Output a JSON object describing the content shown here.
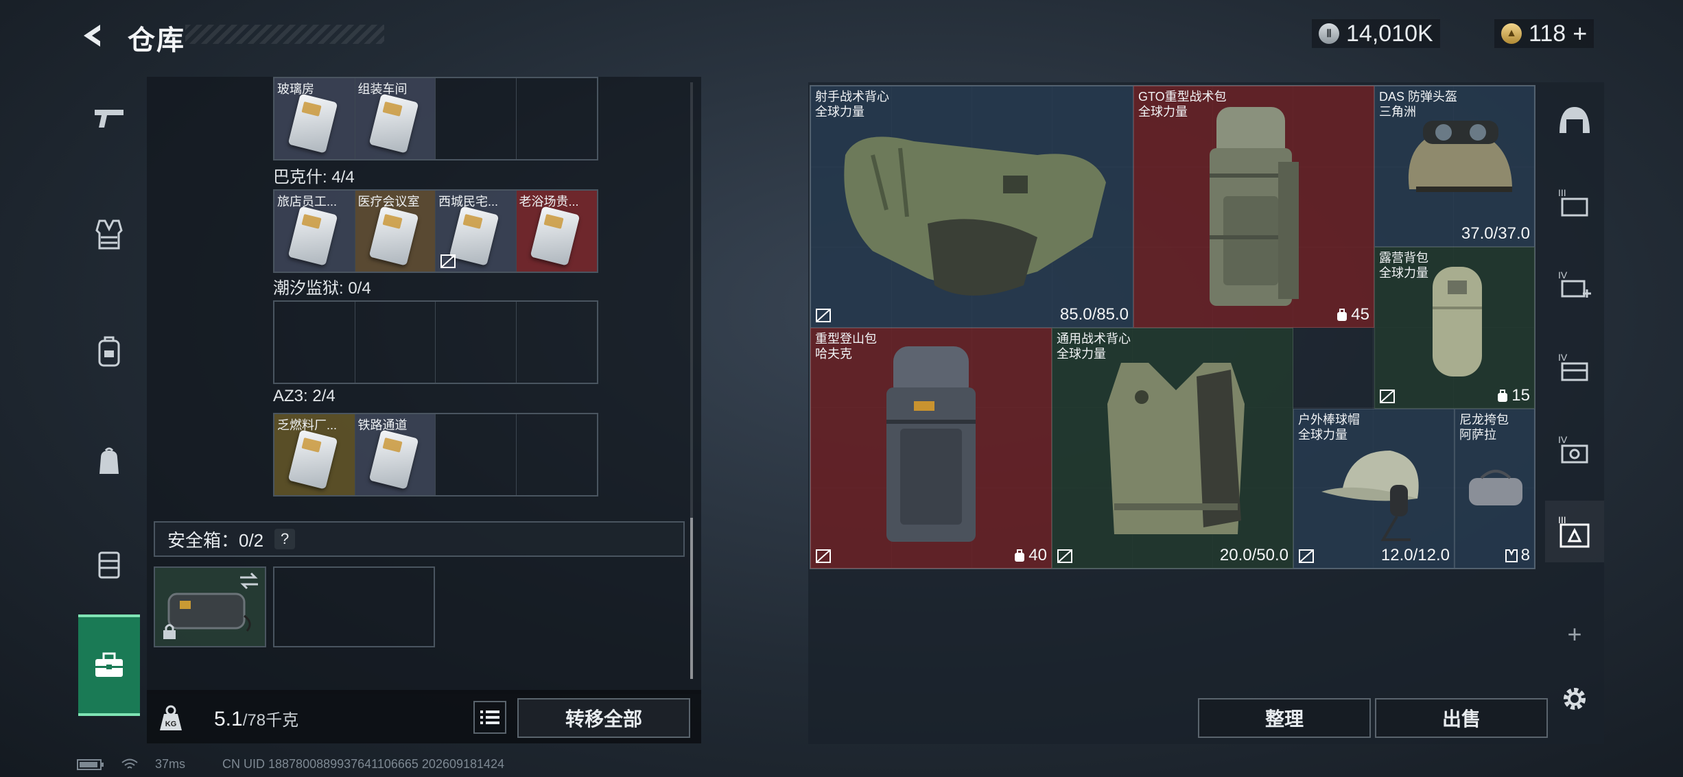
{
  "header": {
    "title": "仓库",
    "currency_silver": "14,010K",
    "currency_gold": "118",
    "plus_label": "+"
  },
  "left_nav": {
    "items": [
      {
        "icon": "pistol-icon"
      },
      {
        "icon": "vest-icon"
      },
      {
        "icon": "backpack-icon"
      },
      {
        "icon": "bag-icon"
      },
      {
        "icon": "rig-icon"
      },
      {
        "icon": "toolbox-icon",
        "active": true
      }
    ]
  },
  "storage": {
    "top_row": {
      "cards": [
        "玻璃房",
        "组装车间",
        "",
        ""
      ]
    },
    "sections": [
      {
        "label": "巴克什: 4/4",
        "cards": [
          "旅店员工...",
          "医疗会议室",
          "西城民宅...",
          "老浴场贵..."
        ]
      },
      {
        "label": "潮汐监狱: 0/4",
        "cards": [
          "",
          "",
          "",
          ""
        ]
      },
      {
        "label": "AZ3: 2/4",
        "cards": [
          "乏燃料厂...",
          "铁路通道",
          "",
          ""
        ]
      }
    ],
    "safe_box_label": "安全箱：0/2",
    "help": "?",
    "weight_value": "5.1",
    "weight_max": "/78千克",
    "transfer_all": "转移全部"
  },
  "inventory": {
    "items": [
      {
        "name1": "射手战术背心",
        "name2": "全球力量",
        "value": "85.0/85.0",
        "color": "blue",
        "kind": "vest"
      },
      {
        "name1": "GTO重型战术包",
        "name2": "全球力量",
        "value": "45",
        "color": "red",
        "kind": "pack"
      },
      {
        "name1": "DAS 防弹头盔",
        "name2": "三角洲",
        "value": "37.0/37.0",
        "color": "blue",
        "kind": "helmet"
      },
      {
        "name1": "露营背包",
        "name2": "全球力量",
        "value": "15",
        "color": "green",
        "kind": "roll"
      },
      {
        "name1": "重型登山包",
        "name2": "哈夫克",
        "value": "40",
        "color": "red",
        "kind": "pack"
      },
      {
        "name1": "通用战术背心",
        "name2": "全球力量",
        "value": "20.0/50.0",
        "color": "green",
        "kind": "vest2"
      },
      {
        "name1": "户外棒球帽",
        "name2": "全球力量",
        "value": "12.0/12.0",
        "color": "blue",
        "kind": "cap"
      },
      {
        "name1": "尼龙挎包",
        "name2": "阿萨拉",
        "value": "8",
        "color": "blue",
        "kind": "duffel"
      }
    ],
    "sort_label": "整理",
    "sell_label": "出售"
  },
  "right_nav": {
    "items": [
      "helmet-slot-icon",
      "armor-iii-icon",
      "armor-iv-add-icon",
      "armor-iv-icon",
      "armor-iv-key-icon",
      "armor-iii-active-icon"
    ],
    "add": "+"
  },
  "status": {
    "ping": "37ms",
    "uid": "CN UID 1887800889937641106665 202609181424"
  }
}
